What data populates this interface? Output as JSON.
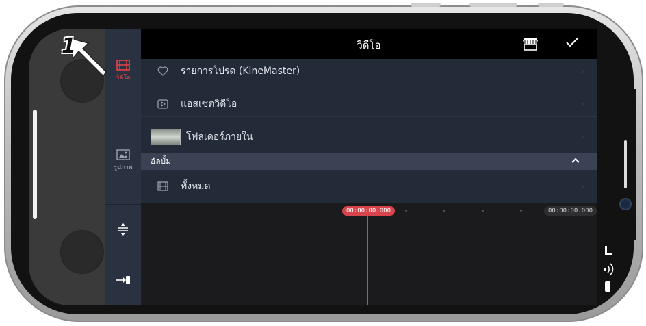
{
  "header": {
    "title": "วิดีโอ"
  },
  "sidebar": {
    "items": [
      {
        "label": "วิดีโอ",
        "icon": "film-icon",
        "active": true
      },
      {
        "label": "รูปภาพ",
        "icon": "image-icon",
        "active": false
      },
      {
        "label": "",
        "icon": "adjust-height-icon",
        "active": false
      },
      {
        "label": "",
        "icon": "import-icon",
        "active": false
      }
    ]
  },
  "list": {
    "items": [
      {
        "label": "รายการโปรด (KineMaster)",
        "icon": "heart-icon"
      },
      {
        "label": "แอสเซตวิดีโอ",
        "icon": "play-box-icon"
      },
      {
        "label": "โฟลเดอร์ภายใน",
        "icon": "folder-thumbnail"
      }
    ],
    "section": {
      "label": "อัลบั้ม"
    },
    "album_items": [
      {
        "label": "ทั้งหมด",
        "icon": "film-icon"
      }
    ]
  },
  "timeline": {
    "current_time": "00:00:00.000",
    "end_time": "00:00:00.000"
  },
  "tutorial": {
    "step": "1"
  },
  "colors": {
    "accent": "#d8444c",
    "panel": "#232a38",
    "sidebar": "#2a3140",
    "header": "#000000"
  }
}
